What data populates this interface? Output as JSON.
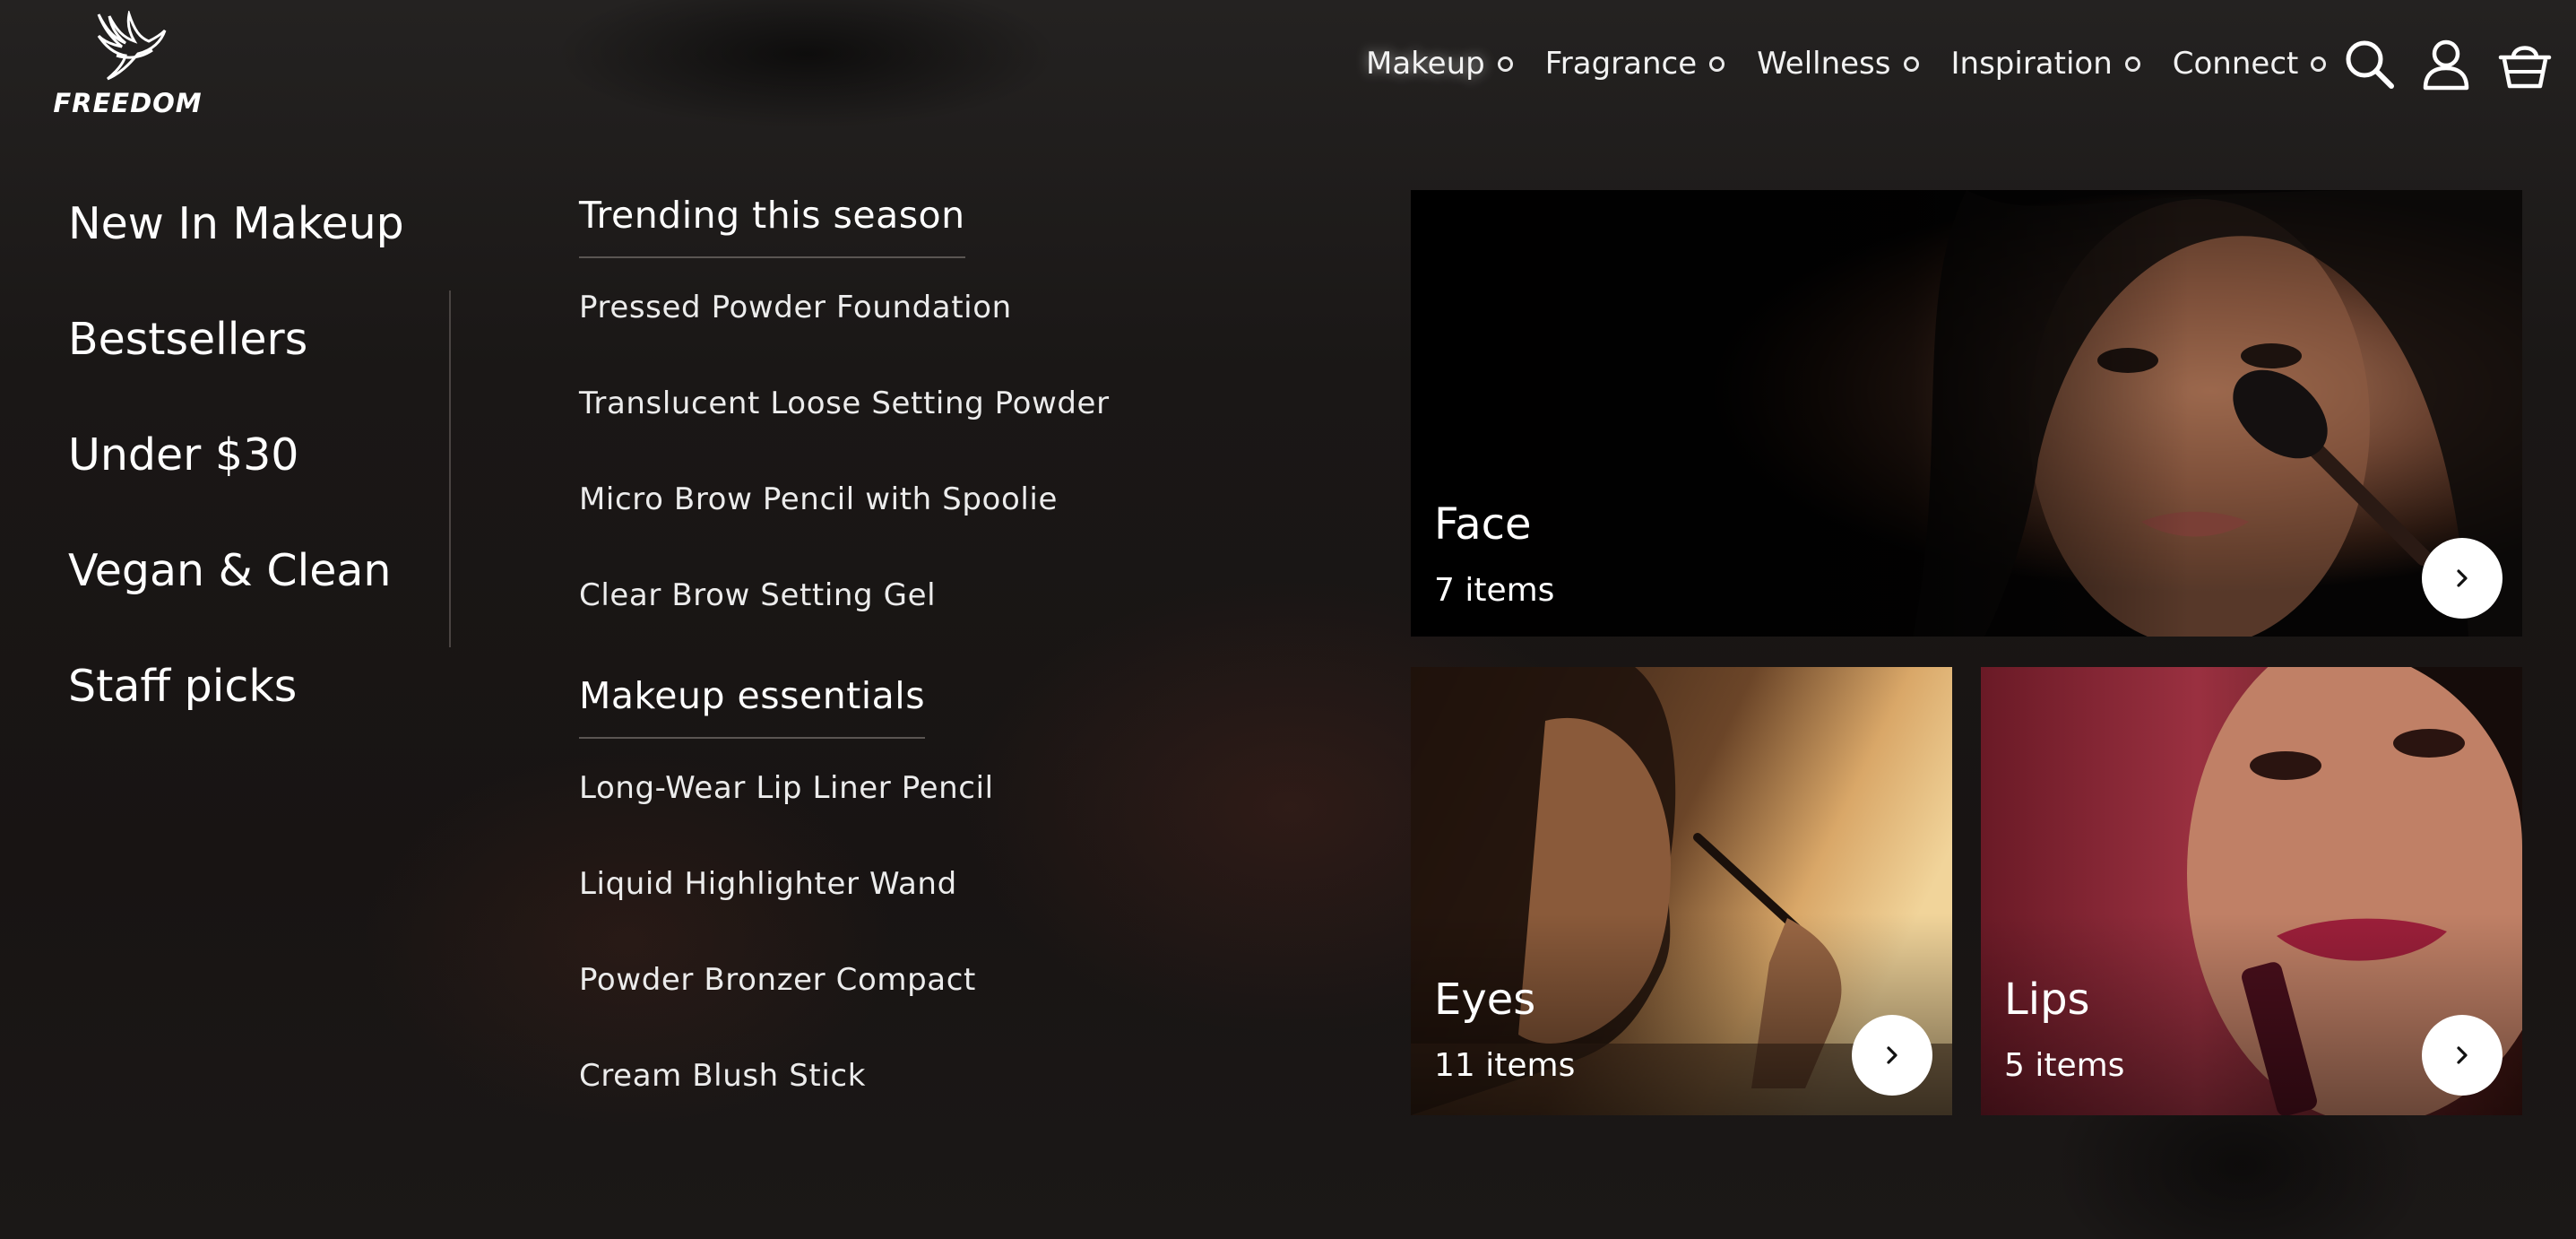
{
  "brand": {
    "name": "FREEDOM"
  },
  "nav": {
    "items": [
      {
        "label": "Makeup",
        "active": true
      },
      {
        "label": "Fragrance",
        "active": false
      },
      {
        "label": "Wellness",
        "active": false
      },
      {
        "label": "Inspiration",
        "active": false
      },
      {
        "label": "Connect",
        "active": false
      }
    ],
    "icons": [
      "search-icon",
      "account-icon",
      "basket-icon"
    ]
  },
  "menu": {
    "quick_links": [
      "New In Makeup",
      "Bestsellers",
      "Under $30",
      "Vegan & Clean",
      "Staff picks"
    ],
    "sections": [
      {
        "heading": "Trending this season",
        "links": [
          "Pressed Powder Foundation",
          "Translucent Loose Setting Powder",
          "Micro Brow Pencil with Spoolie",
          "Clear Brow Setting Gel"
        ]
      },
      {
        "heading": "Makeup essentials",
        "links": [
          "Long-Wear Lip Liner Pencil",
          "Liquid Highlighter Wand",
          "Powder Bronzer Compact",
          "Cream Blush Stick"
        ]
      }
    ],
    "cards": [
      {
        "title": "Face",
        "count": "7 items"
      },
      {
        "title": "Eyes",
        "count": "11 items"
      },
      {
        "title": "Lips",
        "count": "5 items"
      }
    ]
  },
  "colors": {
    "background": "#1b1918",
    "text": "#ffffff",
    "arrow_button": "#ffffff"
  }
}
